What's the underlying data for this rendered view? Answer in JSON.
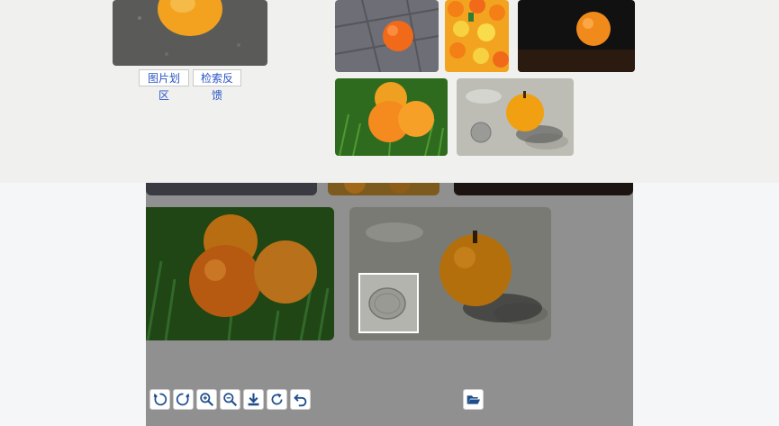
{
  "buttons": {
    "image_region": "图片划区",
    "feedback": "检索反馈"
  },
  "toolbar": {
    "icons": [
      "rotate-left-icon",
      "rotate-right-icon",
      "zoom-in-icon",
      "zoom-out-icon",
      "download-icon",
      "refresh-icon",
      "undo-icon",
      "folder-open-icon"
    ]
  },
  "colors": {
    "link": "#2a56c6",
    "toolbar_icon": "#1f4e8c",
    "viewer_bg": "#909090"
  }
}
